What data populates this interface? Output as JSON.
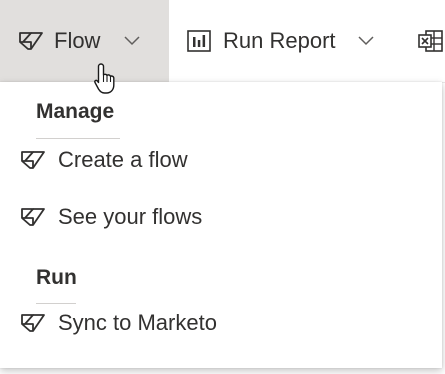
{
  "toolbar": {
    "flow": {
      "label": "Flow",
      "icon": "flow-icon",
      "chevron": "chevron-down-icon"
    },
    "run_report": {
      "label": "Run Report",
      "icon": "report-icon",
      "chevron": "chevron-down-icon"
    },
    "excel": {
      "icon": "excel-icon"
    }
  },
  "flow_menu": {
    "sections": [
      {
        "header": "Manage",
        "items": [
          {
            "label": "Create a flow",
            "icon": "flow-icon"
          },
          {
            "label": "See your flows",
            "icon": "flow-icon"
          }
        ]
      },
      {
        "header": "Run",
        "items": [
          {
            "label": "Sync to Marketo",
            "icon": "flow-icon"
          }
        ]
      }
    ]
  },
  "colors": {
    "active_button_bg": "#e1dfdd",
    "text": "#323130"
  }
}
